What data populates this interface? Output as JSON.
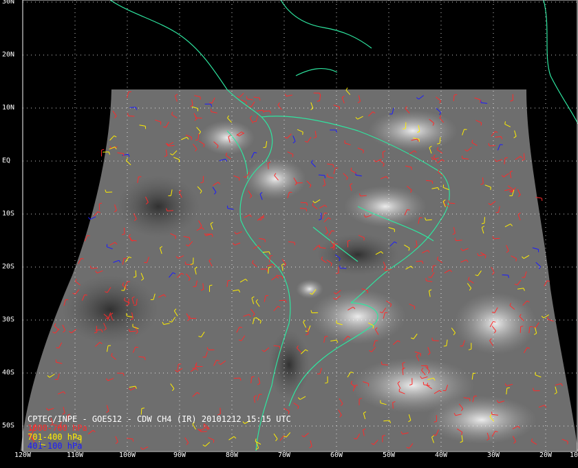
{
  "title": "CPTEC/INPE - GOES12 - CDW CH4 (IR) 20101212 15:15 UTC",
  "legend": [
    {
      "label": "1000-700 hPa",
      "color": "#ff2a2a"
    },
    {
      "label": "701-400 hPa",
      "color": "#ffee00"
    },
    {
      "label": "401-100 hPa",
      "color": "#1a1aff"
    }
  ],
  "latitude_labels": [
    "30N",
    "20N",
    "10N",
    "EQ",
    "10S",
    "20S",
    "30S",
    "40S",
    "50S"
  ],
  "longitude_labels": [
    "120W",
    "110W",
    "100W",
    "90W",
    "80W",
    "70W",
    "60W",
    "50W",
    "40W",
    "30W",
    "20W",
    "10"
  ],
  "colors": {
    "background": "#000000",
    "coastline": "#2ee6a0",
    "grid": "#ffffff",
    "satellite_gray": "#707070",
    "text": "#ffffff"
  }
}
